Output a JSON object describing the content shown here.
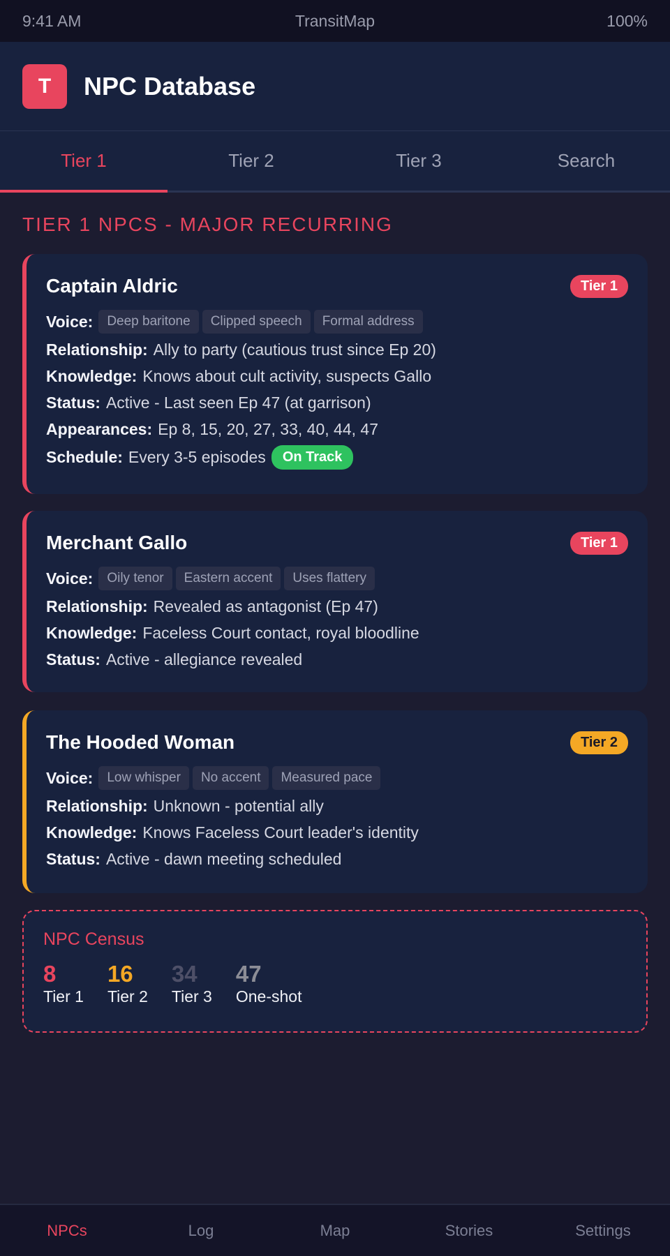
{
  "status_bar": {
    "time": "9:41 AM",
    "app": "TransitMap",
    "battery": "100%"
  },
  "header": {
    "logo_letter": "T",
    "title": "NPC Database"
  },
  "tabs": [
    {
      "label": "Tier 1",
      "active": true
    },
    {
      "label": "Tier 2",
      "active": false
    },
    {
      "label": "Tier 3",
      "active": false
    },
    {
      "label": "Search",
      "active": false
    }
  ],
  "section_title": "TIER 1 NPCS - MAJOR RECURRING",
  "labels": {
    "voice": "Voice:",
    "relationship": "Relationship:",
    "knowledge": "Knowledge:",
    "status": "Status:",
    "appearances": "Appearances:",
    "schedule": "Schedule:"
  },
  "npcs": [
    {
      "name": "Captain Aldric",
      "tier_badge": "Tier 1",
      "voice": [
        "Deep baritone",
        "Clipped speech",
        "Formal address"
      ],
      "relationship": "Ally to party (cautious trust since Ep 20)",
      "knowledge": "Knows about cult activity, suspects Gallo",
      "status": "Active - Last seen Ep 47 (at garrison)",
      "appearances": "Ep 8, 15, 20, 27, 33, 40, 44, 47",
      "schedule": "Every 3-5 episodes",
      "schedule_badge": "On Track"
    },
    {
      "name": "Merchant Gallo",
      "tier_badge": "Tier 1",
      "voice": [
        "Oily tenor",
        "Eastern accent",
        "Uses flattery"
      ],
      "relationship": "Revealed as antagonist (Ep 47)",
      "knowledge": "Faceless Court contact, royal bloodline",
      "status": "Active - allegiance revealed"
    },
    {
      "name": "The Hooded Woman",
      "tier_badge": "Tier 2",
      "voice": [
        "Low whisper",
        "No accent",
        "Measured pace"
      ],
      "relationship": "Unknown - potential ally",
      "knowledge": "Knows Faceless Court leader's identity",
      "status": "Active - dawn meeting scheduled"
    }
  ],
  "census": {
    "title": "NPC Census",
    "stats": [
      {
        "value": "8",
        "label": "Tier 1",
        "color": "#e8455e"
      },
      {
        "value": "16",
        "label": "Tier 2",
        "color": "#f4a825"
      },
      {
        "value": "34",
        "label": "Tier 3",
        "color": "#4e5068"
      },
      {
        "value": "47",
        "label": "One-shot",
        "color": "#8c8d96"
      }
    ]
  },
  "bottom_nav": [
    {
      "label": "NPCs",
      "active": true
    },
    {
      "label": "Log",
      "active": false
    },
    {
      "label": "Map",
      "active": false
    },
    {
      "label": "Stories",
      "active": false
    },
    {
      "label": "Settings",
      "active": false
    }
  ],
  "colors": {
    "accent": "#e8455e",
    "tier2": "#f4a825",
    "success": "#2ec25f",
    "card_bg": "#18223e",
    "page_bg": "#1c1c30"
  }
}
